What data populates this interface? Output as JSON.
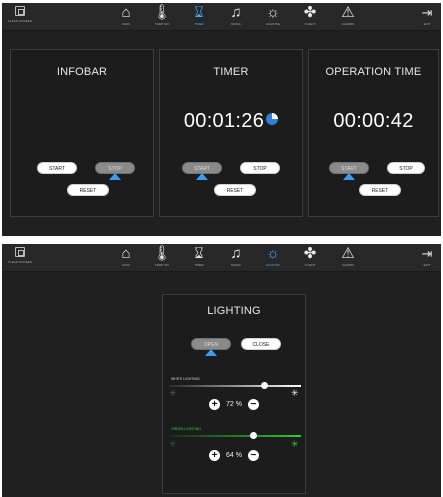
{
  "nav": [
    {
      "key": "main",
      "label": "MAIN",
      "icon": "home-icon"
    },
    {
      "key": "temp",
      "label": "TEMP SIX",
      "icon": "thermometer-icon"
    },
    {
      "key": "timer",
      "label": "TIMER",
      "icon": "hourglass-icon"
    },
    {
      "key": "music",
      "label": "MUSIC",
      "icon": "music-note-icon"
    },
    {
      "key": "lighting",
      "label": "LIGHTING",
      "icon": "light-bulb-icon"
    },
    {
      "key": "fan",
      "label": "X-VENT",
      "icon": "fan-icon"
    },
    {
      "key": "alarms",
      "label": "ALARMS",
      "icon": "warning-triangle-icon"
    }
  ],
  "clean_screen_label": "CLEAN SCREEN",
  "exit_label": "EXIT",
  "screen1": {
    "active_tab": "TIMER",
    "infobar": {
      "title": "INFOBAR",
      "start": "START",
      "stop": "STOP",
      "reset": "RESET",
      "active": "stop"
    },
    "timer": {
      "title": "TIMER",
      "time": "00:01:26",
      "start": "START",
      "stop": "STOP",
      "reset": "RESET",
      "active": "start"
    },
    "operation": {
      "title": "OPERATION TIME",
      "time": "00:00:42",
      "start": "START",
      "stop": "STOP",
      "reset": "RESET",
      "active": "start"
    }
  },
  "screen2": {
    "active_tab": "LIGHTING",
    "lighting": {
      "title": "LIGHTING",
      "open": "OPEN",
      "close": "CLOSE",
      "active": "open",
      "white": {
        "label": "WHITE LIGHTING",
        "percent": 72,
        "display": "72 %"
      },
      "green": {
        "label": "GREEN LIGHTING",
        "percent": 64,
        "display": "64 %"
      }
    }
  },
  "colors": {
    "accent": "#3b9cf6",
    "active_nav": "#4aa6ff",
    "green": "#2ecc2e",
    "bg": "#202020",
    "panel": "#1c1c1c"
  }
}
